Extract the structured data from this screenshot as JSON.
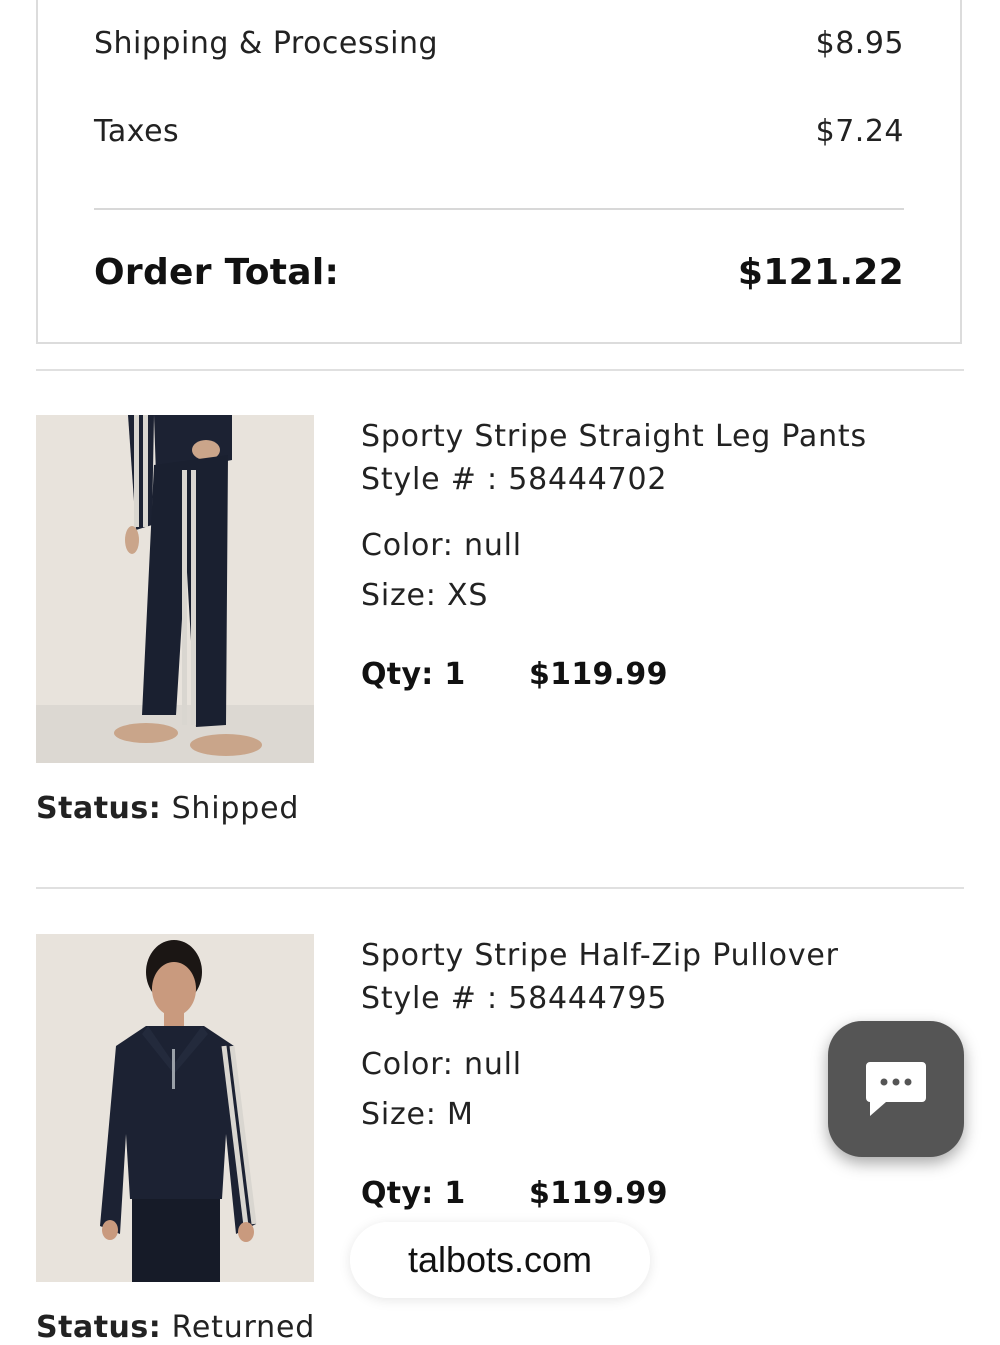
{
  "summary": {
    "shipping_label": "Shipping & Processing",
    "shipping_value": "$8.95",
    "taxes_label": "Taxes",
    "taxes_value": "$7.24",
    "total_label": "Order Total:",
    "total_value": "$121.22"
  },
  "items": [
    {
      "name": "Sporty Stripe Straight Leg Pants",
      "style": "Style # : 58444702",
      "color": "Color: null",
      "size": "Size: XS",
      "qty": "Qty: 1",
      "price": "$119.99",
      "status_label": "Status:",
      "status_value": "Shipped",
      "image_icon": "pants-product-photo"
    },
    {
      "name": "Sporty Stripe Half-Zip Pullover",
      "style": "Style # : 58444795",
      "color": "Color: null",
      "size": "Size: M",
      "qty": "Qty: 1",
      "price": "$119.99",
      "status_label": "Status:",
      "status_value": "Returned",
      "image_icon": "pullover-product-photo"
    }
  ],
  "chat": {
    "icon": "chat-bubble-icon"
  },
  "browser": {
    "url": "talbots.com"
  },
  "colors": {
    "chat_bg": "#555555",
    "product_navy": "#1c2233",
    "stripe": "#d9d6d0"
  }
}
